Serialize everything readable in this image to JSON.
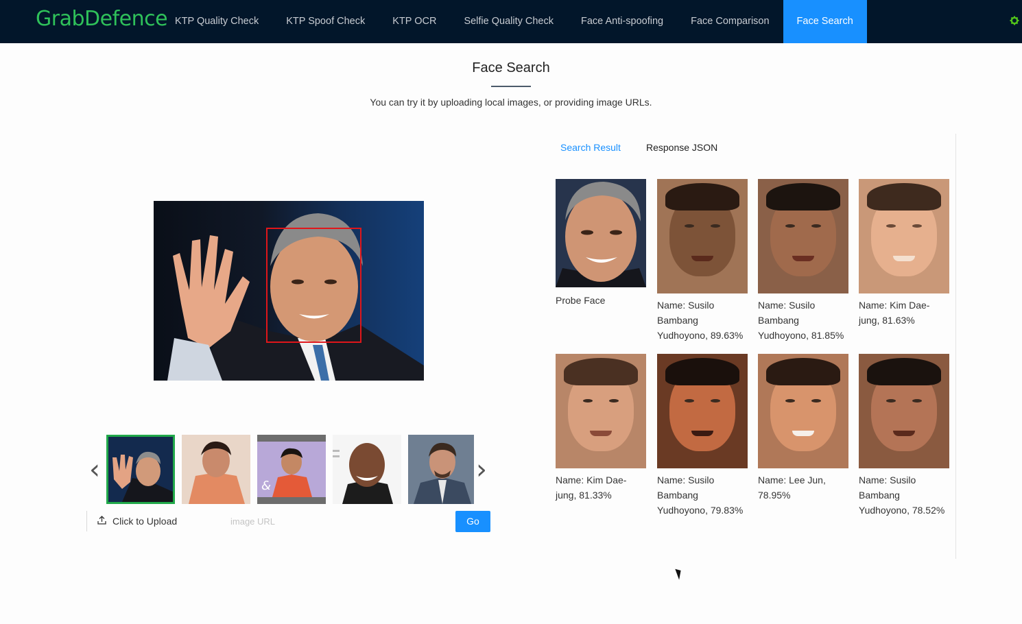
{
  "app": {
    "logo_text": "GrabDefence"
  },
  "nav": {
    "items": [
      {
        "label": "KTP Quality Check"
      },
      {
        "label": "KTP Spoof Check"
      },
      {
        "label": "KTP OCR"
      },
      {
        "label": "Selfie Quality Check"
      },
      {
        "label": "Face Anti-spoofing"
      },
      {
        "label": "Face Comparison"
      },
      {
        "label": "Face Search"
      }
    ],
    "active_index": 6
  },
  "page": {
    "title": "Face Search",
    "subtitle": "You can try it by uploading local images, or providing image URLs."
  },
  "upload": {
    "button_label": "Click to Upload",
    "url_placeholder": "image URL",
    "url_value": "",
    "go_label": "Go"
  },
  "tabs": {
    "search_result": "Search Result",
    "response_json": "Response JSON",
    "active": "search_result"
  },
  "results": {
    "probe_caption": "Probe Face",
    "matches": [
      {
        "caption": "Name: Susilo Bambang Yudhoyono, 89.63%"
      },
      {
        "caption": "Name: Susilo Bambang Yudhoyono, 81.85%"
      },
      {
        "caption": "Name: Kim Dae-jung, 81.63%"
      },
      {
        "caption": "Name: Kim Dae-jung, 81.33%"
      },
      {
        "caption": "Name: Susilo Bambang Yudhoyono, 79.83%"
      },
      {
        "caption": "Name: Lee Jun, 78.95%"
      },
      {
        "caption": "Name: Susilo Bambang Yudhoyono, 78.52%"
      }
    ]
  },
  "carousel": {
    "selected_index": 0,
    "count": 5
  },
  "colors": {
    "nav_bg": "#02162a",
    "accent": "#1890ff",
    "logo_green": "#2fc15a",
    "detection_box": "#e0161a",
    "thumb_selected": "#21a94a"
  }
}
